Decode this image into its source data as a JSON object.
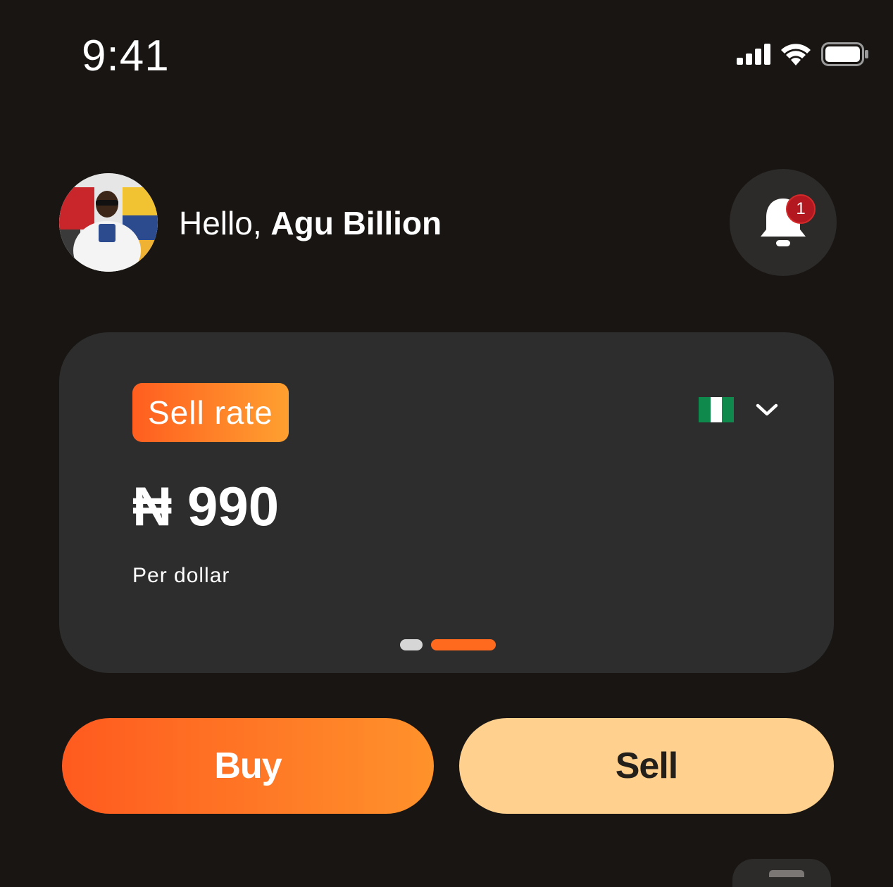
{
  "status_bar": {
    "time": "9:41",
    "icons": [
      "cellular-signal-icon",
      "wifi-icon",
      "battery-icon"
    ]
  },
  "header": {
    "greeting_prefix": "Hello, ",
    "user_name": "Agu Billion",
    "avatar": "user-avatar-photo",
    "notification_count": "1",
    "notification_icon": "bell-icon"
  },
  "rate_card": {
    "badge_label": "Sell rate",
    "country_flag": "nigeria-flag-icon",
    "dropdown_icon": "chevron-down-icon",
    "rate": "₦ 990",
    "unit": "Per dollar",
    "pagination": {
      "total": 2,
      "active_index": 1
    }
  },
  "actions": {
    "buy_label": "Buy",
    "sell_label": "Sell"
  },
  "colors": {
    "background": "#181513",
    "card": "#2d2d2d",
    "accent_start": "#ff5a1f",
    "accent_end": "#ffa030",
    "sell_button": "#ffd08e",
    "badge_red": "#b3171f",
    "flag_green": "#0f8a4c"
  }
}
